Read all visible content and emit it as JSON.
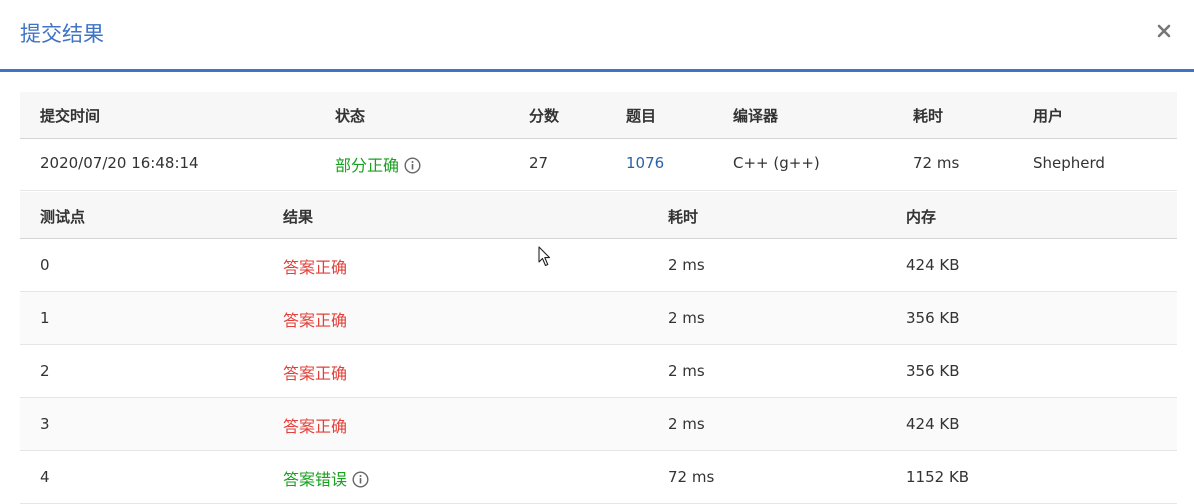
{
  "dialog": {
    "title": "提交结果"
  },
  "summary": {
    "headers": {
      "time": "提交时间",
      "status": "状态",
      "score": "分数",
      "problem": "题目",
      "compiler": "编译器",
      "elapsed": "耗时",
      "user": "用户"
    },
    "row": {
      "time": "2020/07/20 16:48:14",
      "status": "部分正确",
      "score": "27",
      "problem": "1076",
      "compiler": "C++ (g++)",
      "elapsed": "72 ms",
      "user": "Shepherd"
    }
  },
  "cases": {
    "headers": {
      "case": "测试点",
      "result": "结果",
      "elapsed": "耗时",
      "memory": "内存"
    },
    "rows": [
      {
        "case": "0",
        "result": "答案正确",
        "elapsed": "2 ms",
        "memory": "424 KB"
      },
      {
        "case": "1",
        "result": "答案正确",
        "elapsed": "2 ms",
        "memory": "356 KB"
      },
      {
        "case": "2",
        "result": "答案正确",
        "elapsed": "2 ms",
        "memory": "356 KB"
      },
      {
        "case": "3",
        "result": "答案正确",
        "elapsed": "2 ms",
        "memory": "424 KB"
      },
      {
        "case": "4",
        "result": "答案错误",
        "elapsed": "72 ms",
        "memory": "1152 KB"
      }
    ]
  },
  "colors": {
    "accent": "#3f73c4",
    "success_text": "#19a11f",
    "ok_text": "#e2413b",
    "link": "#2a62a8"
  },
  "icons": {
    "close": "close-icon",
    "info": "info-icon",
    "cursor": "mouse-cursor-icon"
  }
}
